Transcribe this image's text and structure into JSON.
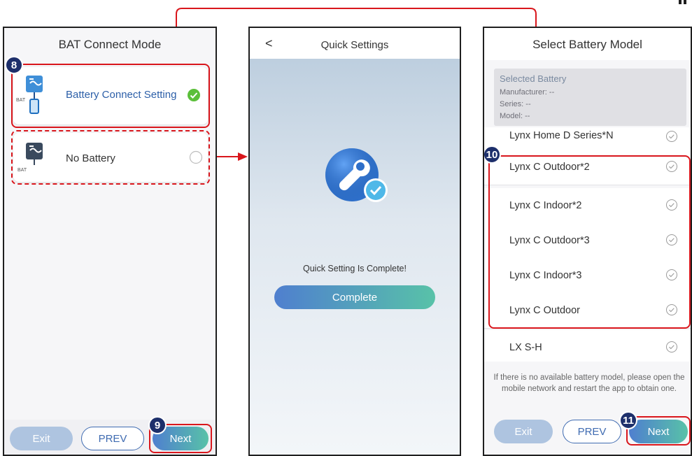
{
  "panel1": {
    "title": "BAT Connect Mode",
    "options": [
      {
        "label": "Battery Connect Setting",
        "icon_sub": "BAT",
        "selected": true
      },
      {
        "label": "No Battery",
        "icon_sub": "BAT",
        "selected": false
      }
    ],
    "buttons": {
      "exit": "Exit",
      "prev": "PREV",
      "next": "Next"
    }
  },
  "panel2": {
    "back_glyph": "<",
    "title": "Quick Settings",
    "message": "Quick Setting Is Complete!",
    "complete_button": "Complete"
  },
  "panel3": {
    "title": "Select Battery Model",
    "selected_box": {
      "heading": "Selected Battery",
      "manufacturer": "Manufacturer:  --",
      "series": "Series:  --",
      "model": "Model:  --"
    },
    "models": [
      "Lynx Home D Series*N",
      "Lynx C Outdoor*2",
      "Lynx C Indoor*2",
      "Lynx C Outdoor*3",
      "Lynx C Indoor*3",
      "Lynx C Outdoor",
      "LX S-H"
    ],
    "notice": "If there is no available battery model, please open the mobile network and restart the app to obtain one.",
    "buttons": {
      "exit": "Exit",
      "prev": "PREV",
      "next": "Next"
    }
  },
  "annotations": [
    "8",
    "9",
    "10",
    "11"
  ],
  "colors": {
    "accent_red": "#d9161c",
    "badge_navy": "#1d2f6b",
    "brand_blue": "#3f6bb1",
    "success_green": "#5bbf3a"
  }
}
